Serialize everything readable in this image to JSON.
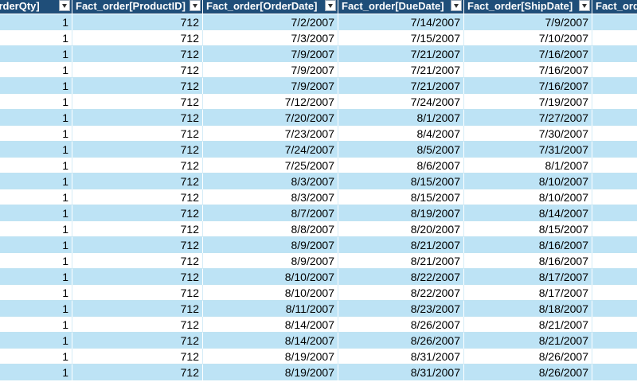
{
  "columns": [
    "[OrderQty]",
    "Fact_order[ProductID]",
    "Fact_order[OrderDate]",
    "Fact_order[DueDate]",
    "Fact_order[ShipDate]",
    "Fact_orde"
  ],
  "colors": {
    "header_bg": "#1f4e79",
    "header_text": "#ffffff",
    "band_bg": "#bde3f5",
    "plain_bg": "#ffffff"
  },
  "rows": [
    [
      "1",
      "712",
      "7/2/2007",
      "7/14/2007",
      "7/9/2007",
      ""
    ],
    [
      "1",
      "712",
      "7/3/2007",
      "7/15/2007",
      "7/10/2007",
      ""
    ],
    [
      "1",
      "712",
      "7/9/2007",
      "7/21/2007",
      "7/16/2007",
      ""
    ],
    [
      "1",
      "712",
      "7/9/2007",
      "7/21/2007",
      "7/16/2007",
      ""
    ],
    [
      "1",
      "712",
      "7/9/2007",
      "7/21/2007",
      "7/16/2007",
      ""
    ],
    [
      "1",
      "712",
      "7/12/2007",
      "7/24/2007",
      "7/19/2007",
      ""
    ],
    [
      "1",
      "712",
      "7/20/2007",
      "8/1/2007",
      "7/27/2007",
      ""
    ],
    [
      "1",
      "712",
      "7/23/2007",
      "8/4/2007",
      "7/30/2007",
      ""
    ],
    [
      "1",
      "712",
      "7/24/2007",
      "8/5/2007",
      "7/31/2007",
      ""
    ],
    [
      "1",
      "712",
      "7/25/2007",
      "8/6/2007",
      "8/1/2007",
      ""
    ],
    [
      "1",
      "712",
      "8/3/2007",
      "8/15/2007",
      "8/10/2007",
      ""
    ],
    [
      "1",
      "712",
      "8/3/2007",
      "8/15/2007",
      "8/10/2007",
      ""
    ],
    [
      "1",
      "712",
      "8/7/2007",
      "8/19/2007",
      "8/14/2007",
      ""
    ],
    [
      "1",
      "712",
      "8/8/2007",
      "8/20/2007",
      "8/15/2007",
      ""
    ],
    [
      "1",
      "712",
      "8/9/2007",
      "8/21/2007",
      "8/16/2007",
      ""
    ],
    [
      "1",
      "712",
      "8/9/2007",
      "8/21/2007",
      "8/16/2007",
      ""
    ],
    [
      "1",
      "712",
      "8/10/2007",
      "8/22/2007",
      "8/17/2007",
      ""
    ],
    [
      "1",
      "712",
      "8/10/2007",
      "8/22/2007",
      "8/17/2007",
      ""
    ],
    [
      "1",
      "712",
      "8/11/2007",
      "8/23/2007",
      "8/18/2007",
      ""
    ],
    [
      "1",
      "712",
      "8/14/2007",
      "8/26/2007",
      "8/21/2007",
      ""
    ],
    [
      "1",
      "712",
      "8/14/2007",
      "8/26/2007",
      "8/21/2007",
      ""
    ],
    [
      "1",
      "712",
      "8/19/2007",
      "8/31/2007",
      "8/26/2007",
      ""
    ],
    [
      "1",
      "712",
      "8/19/2007",
      "8/31/2007",
      "8/26/2007",
      ""
    ]
  ]
}
